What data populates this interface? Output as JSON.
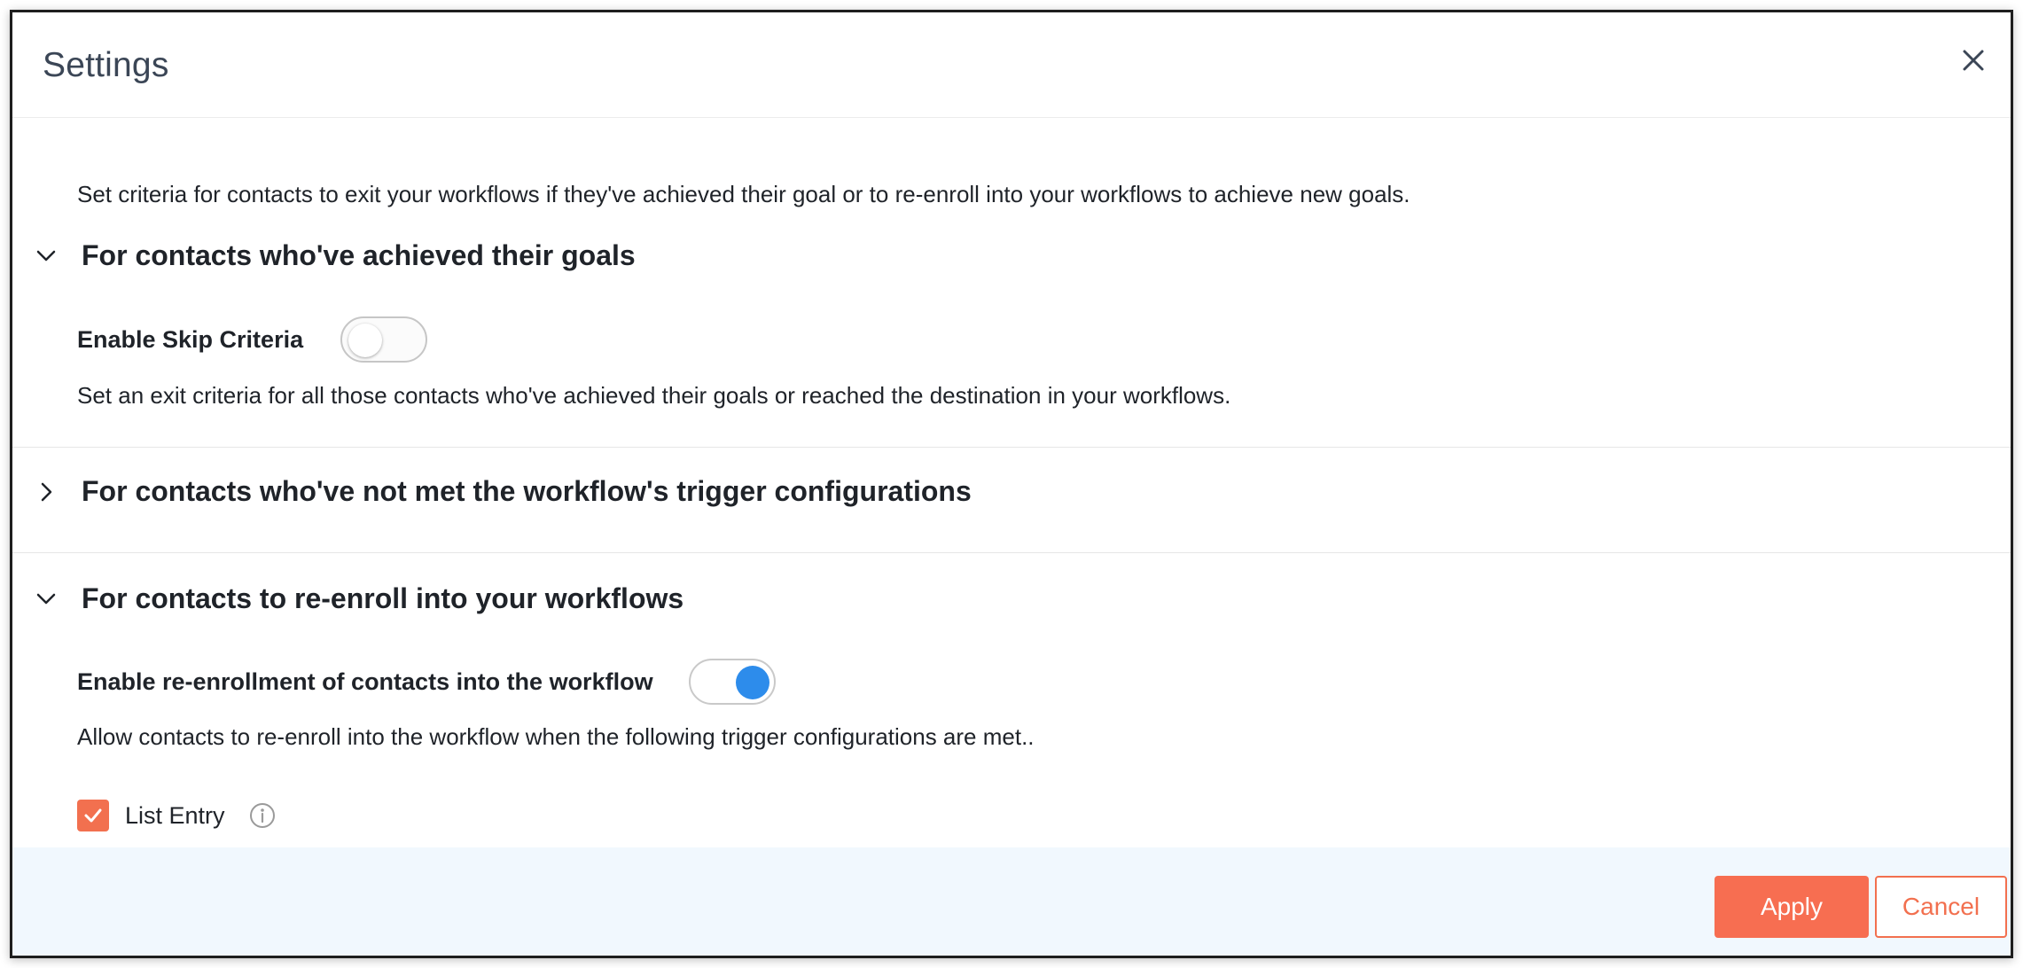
{
  "dialog": {
    "title": "Settings",
    "close_icon": "close-icon"
  },
  "intro": "Set criteria for contacts to exit your workflows if they've achieved their goal or to re-enroll into your workflows to achieve new goals.",
  "sections": [
    {
      "title": "For contacts who've achieved their goals",
      "expanded": true,
      "toggle_label": "Enable Skip Criteria",
      "toggle_on": false,
      "description": "Set an exit criteria for all those contacts who've achieved their goals or reached the destination in your workflows."
    },
    {
      "title": "For contacts who've not met the workflow's trigger configurations",
      "expanded": false
    },
    {
      "title": "For contacts to re-enroll into your workflows",
      "expanded": true,
      "toggle_label": "Enable re-enrollment of contacts into the workflow",
      "toggle_on": true,
      "description": "Allow contacts to re-enroll into the workflow when the following trigger configurations are met..",
      "checkbox": {
        "label": "List Entry",
        "checked": true,
        "info_icon": "info-icon"
      }
    }
  ],
  "footer": {
    "apply_label": "Apply",
    "cancel_label": "Cancel"
  },
  "colors": {
    "accent": "#f76e51",
    "toggle_on": "#2d8ceb",
    "footer_bg": "#f1f8fe",
    "title": "#3b4656"
  }
}
